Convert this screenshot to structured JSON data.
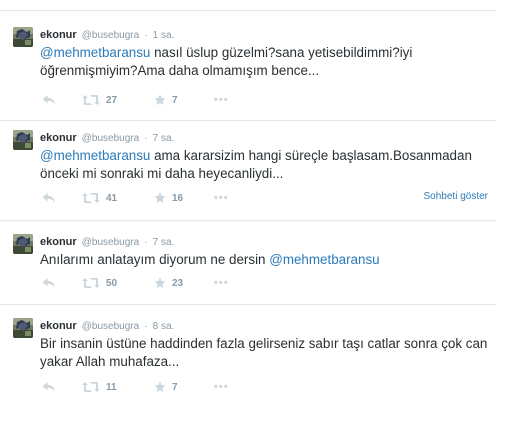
{
  "tweets": [
    {
      "fullname": "ekonur",
      "username": "@busebugra",
      "time": "1 sa.",
      "mention": "@mehmetbaransu",
      "text": " nasıl üslup güzelmi?sana yetisebildimmi?iyi öğrenmişmiyim?Ama daha olmamışım bence...",
      "retweets": "27",
      "favorites": "7"
    },
    {
      "fullname": "ekonur",
      "username": "@busebugra",
      "time": "7 sa.",
      "mention": "@mehmetbaransu",
      "text": " ama kararsizim hangi süreçle başlasam.Bosanmadan önceki mi sonraki mi daha heyecanliydi...",
      "retweets": "41",
      "favorites": "16",
      "conversation_link": "Sohbeti göster"
    },
    {
      "fullname": "ekonur",
      "username": "@busebugra",
      "time": "7 sa.",
      "text": "Anılarımı anlatayım diyorum ne dersin ",
      "mention": "@mehmetbaransu",
      "retweets": "50",
      "favorites": "23"
    },
    {
      "fullname": "ekonur",
      "username": "@busebugra",
      "time": "8 sa.",
      "text": "Bir insanin üstüne haddinden fazla gelirseniz sabır taşı catlar sonra çok can yakar Allah muhafaza...",
      "retweets": "11",
      "favorites": "7"
    }
  ],
  "separator": "·",
  "more_glyph": "•••",
  "icons": {
    "reply": "reply-icon",
    "retweet": "retweet-icon",
    "favorite": "star-icon",
    "more": "more-icon",
    "avatar": "avatar-image"
  },
  "colors": {
    "link": "#2b7bb9",
    "text": "#292f33",
    "muted": "#8899a6",
    "icon": "#ccd6dd",
    "border": "#e1e8ed"
  }
}
